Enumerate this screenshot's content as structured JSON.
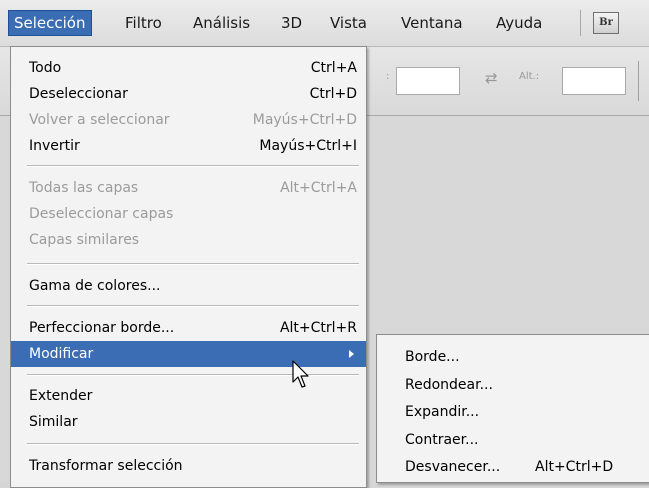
{
  "menubar": {
    "items": [
      {
        "label": "Selección",
        "active": true
      },
      {
        "label": "Filtro"
      },
      {
        "label": "Análisis"
      },
      {
        "label": "3D"
      },
      {
        "label": "Vista"
      },
      {
        "label": "Ventana"
      },
      {
        "label": "Ayuda"
      }
    ],
    "bridge_badge": "Br"
  },
  "options_bar": {
    "height_label": "Alt.:",
    "colon": ":",
    "swap_icon": "swap-arrows-icon"
  },
  "menu": {
    "items": [
      {
        "label": "Todo",
        "shortcut": "Ctrl+A",
        "enabled": true
      },
      {
        "label": "Deseleccionar",
        "shortcut": "Ctrl+D",
        "enabled": true
      },
      {
        "label": "Volver a seleccionar",
        "shortcut": "Mayús+Ctrl+D",
        "enabled": false
      },
      {
        "label": "Invertir",
        "shortcut": "Mayús+Ctrl+I",
        "enabled": true
      },
      {
        "label": "Todas las capas",
        "shortcut": "Alt+Ctrl+A",
        "enabled": false
      },
      {
        "label": "Deseleccionar capas",
        "shortcut": "",
        "enabled": false
      },
      {
        "label": "Capas similares",
        "shortcut": "",
        "enabled": false
      },
      {
        "label": "Gama de colores...",
        "shortcut": "",
        "enabled": true
      },
      {
        "label": "Perfeccionar borde...",
        "shortcut": "Alt+Ctrl+R",
        "enabled": true
      },
      {
        "label": "Modificar",
        "shortcut": "",
        "enabled": true,
        "highlighted": true,
        "has_submenu": true
      },
      {
        "label": "Extender",
        "shortcut": "",
        "enabled": true
      },
      {
        "label": "Similar",
        "shortcut": "",
        "enabled": true
      },
      {
        "label": "Transformar selección",
        "shortcut": "",
        "enabled": true
      }
    ]
  },
  "submenu": {
    "items": [
      {
        "label": "Borde...",
        "shortcut": ""
      },
      {
        "label": "Redondear...",
        "shortcut": ""
      },
      {
        "label": "Expandir...",
        "shortcut": ""
      },
      {
        "label": "Contraer...",
        "shortcut": ""
      },
      {
        "label": "Desvanecer...",
        "shortcut": "Alt+Ctrl+D"
      }
    ]
  },
  "colors": {
    "highlight": "#3b6db4",
    "disabled_text": "#9b9b9b",
    "menu_bg": "#f3f3f3"
  }
}
